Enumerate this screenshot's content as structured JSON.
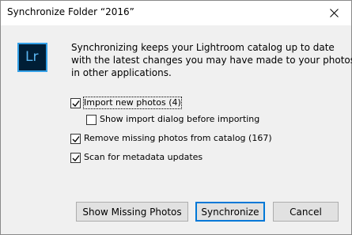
{
  "window": {
    "title": "Synchronize Folder “2016”"
  },
  "logo": {
    "text": "Lr",
    "bg_color": "#001e36",
    "accent_color": "#34a0e7"
  },
  "message": {
    "lines": [
      "Synchronizing keeps your Lightroom catalog up to date",
      "with the latest changes you may have made to your photos",
      "in other applications."
    ]
  },
  "options": [
    {
      "label": "Import new photos (4)",
      "checked": true
    },
    {
      "label": "Show import dialog before importing",
      "checked": false
    },
    {
      "label": "Remove missing photos from catalog (167)",
      "checked": true
    },
    {
      "label": "Scan for metadata updates",
      "checked": true
    }
  ],
  "buttons": {
    "show_missing": "Show Missing Photos",
    "synchronize": "Synchronize",
    "cancel": "Cancel"
  },
  "icons": {
    "close": "close-icon",
    "check": "checkmark-icon"
  },
  "colors": {
    "default_button_border": "#0078d7"
  }
}
